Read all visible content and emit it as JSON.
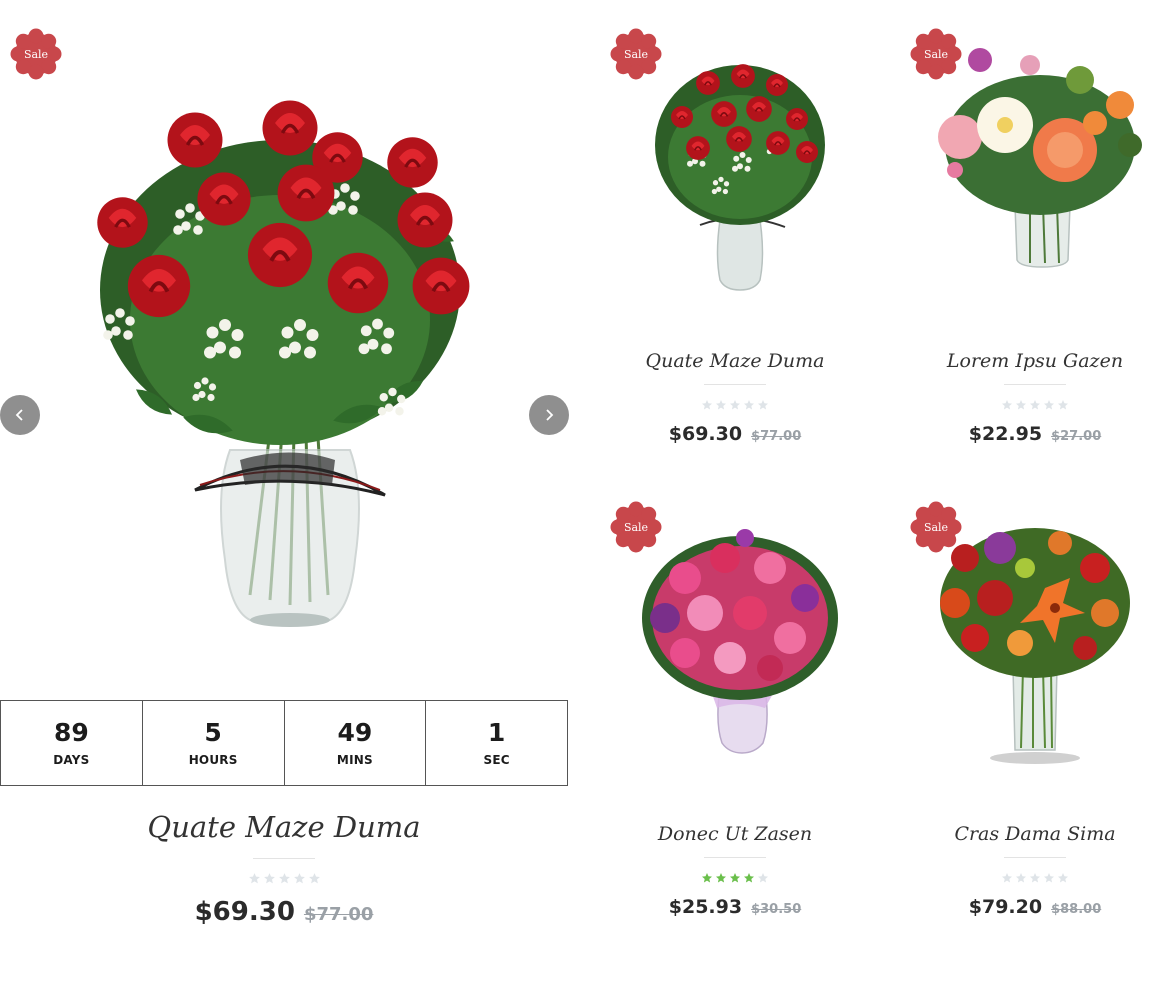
{
  "sale_label": "Sale",
  "colors": {
    "sale_badge": "#c8474b",
    "star_empty": "#dfe4e8",
    "star_filled": "#6abf4b",
    "arrow_bg": "#8f8f8f",
    "old_price": "#9aa0a6"
  },
  "featured": {
    "title": "Quate Maze Duma",
    "price": "$69.30",
    "old_price": "$77.00",
    "rating": 0,
    "image_icon": "red-roses-bouquet-image",
    "countdown": [
      {
        "value": "89",
        "label": "DAYS"
      },
      {
        "value": "5",
        "label": "HOURS"
      },
      {
        "value": "49",
        "label": "MINS"
      },
      {
        "value": "1",
        "label": "SEC"
      }
    ],
    "prev_icon": "chevron-left-icon",
    "next_icon": "chevron-right-icon"
  },
  "products": [
    {
      "title": "Quate Maze Duma",
      "price": "$69.30",
      "old_price": "$77.00",
      "rating": 0,
      "image_icon": "red-roses-vase-image"
    },
    {
      "title": "Lorem Ipsu Gazen",
      "price": "$22.95",
      "old_price": "$27.00",
      "rating": 0,
      "image_icon": "peony-bouquet-image"
    },
    {
      "title": "Donec Ut Zasen",
      "price": "$25.93",
      "old_price": "$30.50",
      "rating": 4,
      "image_icon": "pink-flowers-bouquet-image"
    },
    {
      "title": "Cras Dama Sima",
      "price": "$79.20",
      "old_price": "$88.00",
      "rating": 0,
      "image_icon": "orange-lilies-bouquet-image"
    }
  ]
}
